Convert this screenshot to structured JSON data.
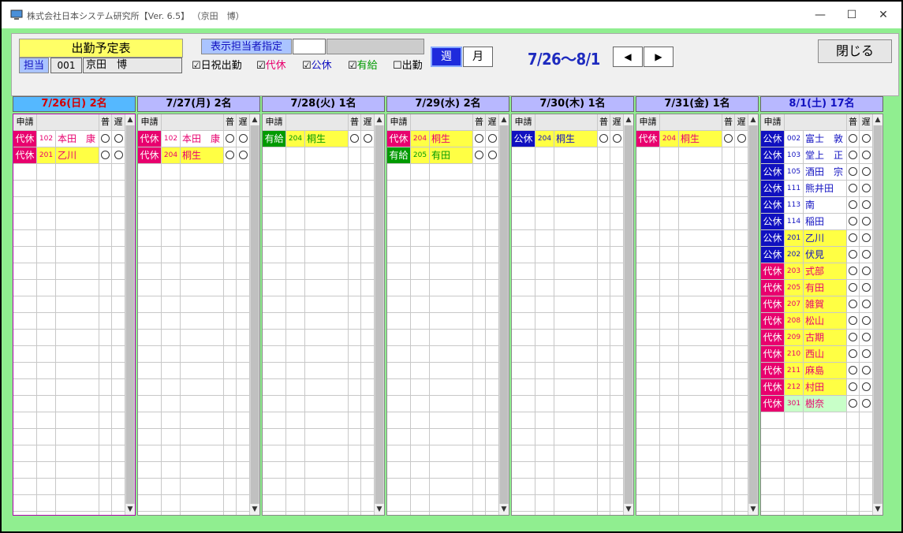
{
  "window": {
    "title": "株式会社日本システム研究所【Ver. 6.5】 （京田　博）",
    "minimize": "—",
    "maximize": "☐",
    "close": "✕"
  },
  "header": {
    "sched_title": "出勤予定表",
    "tanto_label": "担当",
    "tanto_code": "001",
    "tanto_name": "京田　博",
    "disp_label": "表示担当者指定",
    "checks": [
      {
        "label": "日祝出勤",
        "checked": true,
        "color": "#000000"
      },
      {
        "label": "代休",
        "checked": true,
        "color": "#e8006e"
      },
      {
        "label": "公休",
        "checked": true,
        "color": "#1010c0"
      },
      {
        "label": "有給",
        "checked": true,
        "color": "#009a00"
      },
      {
        "label": "出勤",
        "checked": false,
        "color": "#000000"
      }
    ],
    "week_label": "週",
    "month_label": "月",
    "range": "7/26～8/1",
    "prev": "◀",
    "next": "▶",
    "close_label": "閉じる"
  },
  "columns": {
    "request": "申請",
    "normal": "普",
    "late": "遅"
  },
  "days": [
    {
      "label": "7/26(日) 2名",
      "type": "sun",
      "entries": [
        {
          "kind": "代休",
          "code": "102",
          "name": "本田　康",
          "bg": "white"
        },
        {
          "kind": "代休",
          "code": "201",
          "name": "乙川",
          "bg": "yellow"
        }
      ]
    },
    {
      "label": "7/27(月) 2名",
      "type": "week",
      "entries": [
        {
          "kind": "代休",
          "code": "102",
          "name": "本田　康",
          "bg": "white"
        },
        {
          "kind": "代休",
          "code": "204",
          "name": "桐生",
          "bg": "yellow"
        }
      ]
    },
    {
      "label": "7/28(火) 1名",
      "type": "week",
      "entries": [
        {
          "kind": "有給",
          "code": "204",
          "name": "桐生",
          "bg": "yellow"
        }
      ]
    },
    {
      "label": "7/29(水) 2名",
      "type": "week",
      "entries": [
        {
          "kind": "代休",
          "code": "204",
          "name": "桐生",
          "bg": "yellow"
        },
        {
          "kind": "有給",
          "code": "205",
          "name": "有田",
          "bg": "yellow"
        }
      ]
    },
    {
      "label": "7/30(木) 1名",
      "type": "week",
      "entries": [
        {
          "kind": "公休",
          "code": "204",
          "name": "桐生",
          "bg": "yellow"
        }
      ]
    },
    {
      "label": "7/31(金) 1名",
      "type": "week",
      "entries": [
        {
          "kind": "代休",
          "code": "204",
          "name": "桐生",
          "bg": "yellow"
        }
      ]
    },
    {
      "label": "8/1(土) 17名",
      "type": "sat",
      "entries": [
        {
          "kind": "公休",
          "code": "002",
          "name": "富士　敦",
          "bg": "white"
        },
        {
          "kind": "公休",
          "code": "103",
          "name": "堂上　正",
          "bg": "white"
        },
        {
          "kind": "公休",
          "code": "105",
          "name": "酒田　宗",
          "bg": "white"
        },
        {
          "kind": "公休",
          "code": "111",
          "name": "熊井田",
          "bg": "white"
        },
        {
          "kind": "公休",
          "code": "113",
          "name": "南",
          "bg": "white"
        },
        {
          "kind": "公休",
          "code": "114",
          "name": "稲田",
          "bg": "white"
        },
        {
          "kind": "公休",
          "code": "201",
          "name": "乙川",
          "bg": "yellow"
        },
        {
          "kind": "公休",
          "code": "202",
          "name": "伏見",
          "bg": "yellow"
        },
        {
          "kind": "代休",
          "code": "203",
          "name": "式部",
          "bg": "yellow"
        },
        {
          "kind": "代休",
          "code": "205",
          "name": "有田",
          "bg": "yellow"
        },
        {
          "kind": "代休",
          "code": "207",
          "name": "雑賀",
          "bg": "yellow"
        },
        {
          "kind": "代休",
          "code": "208",
          "name": "松山",
          "bg": "yellow"
        },
        {
          "kind": "代休",
          "code": "209",
          "name": "古期",
          "bg": "yellow"
        },
        {
          "kind": "代休",
          "code": "210",
          "name": "西山",
          "bg": "yellow"
        },
        {
          "kind": "代休",
          "code": "211",
          "name": "麻島",
          "bg": "yellow"
        },
        {
          "kind": "代休",
          "code": "212",
          "name": "村田",
          "bg": "yellow"
        },
        {
          "kind": "代休",
          "code": "301",
          "name": "樹奈",
          "bg": "green"
        }
      ]
    }
  ]
}
